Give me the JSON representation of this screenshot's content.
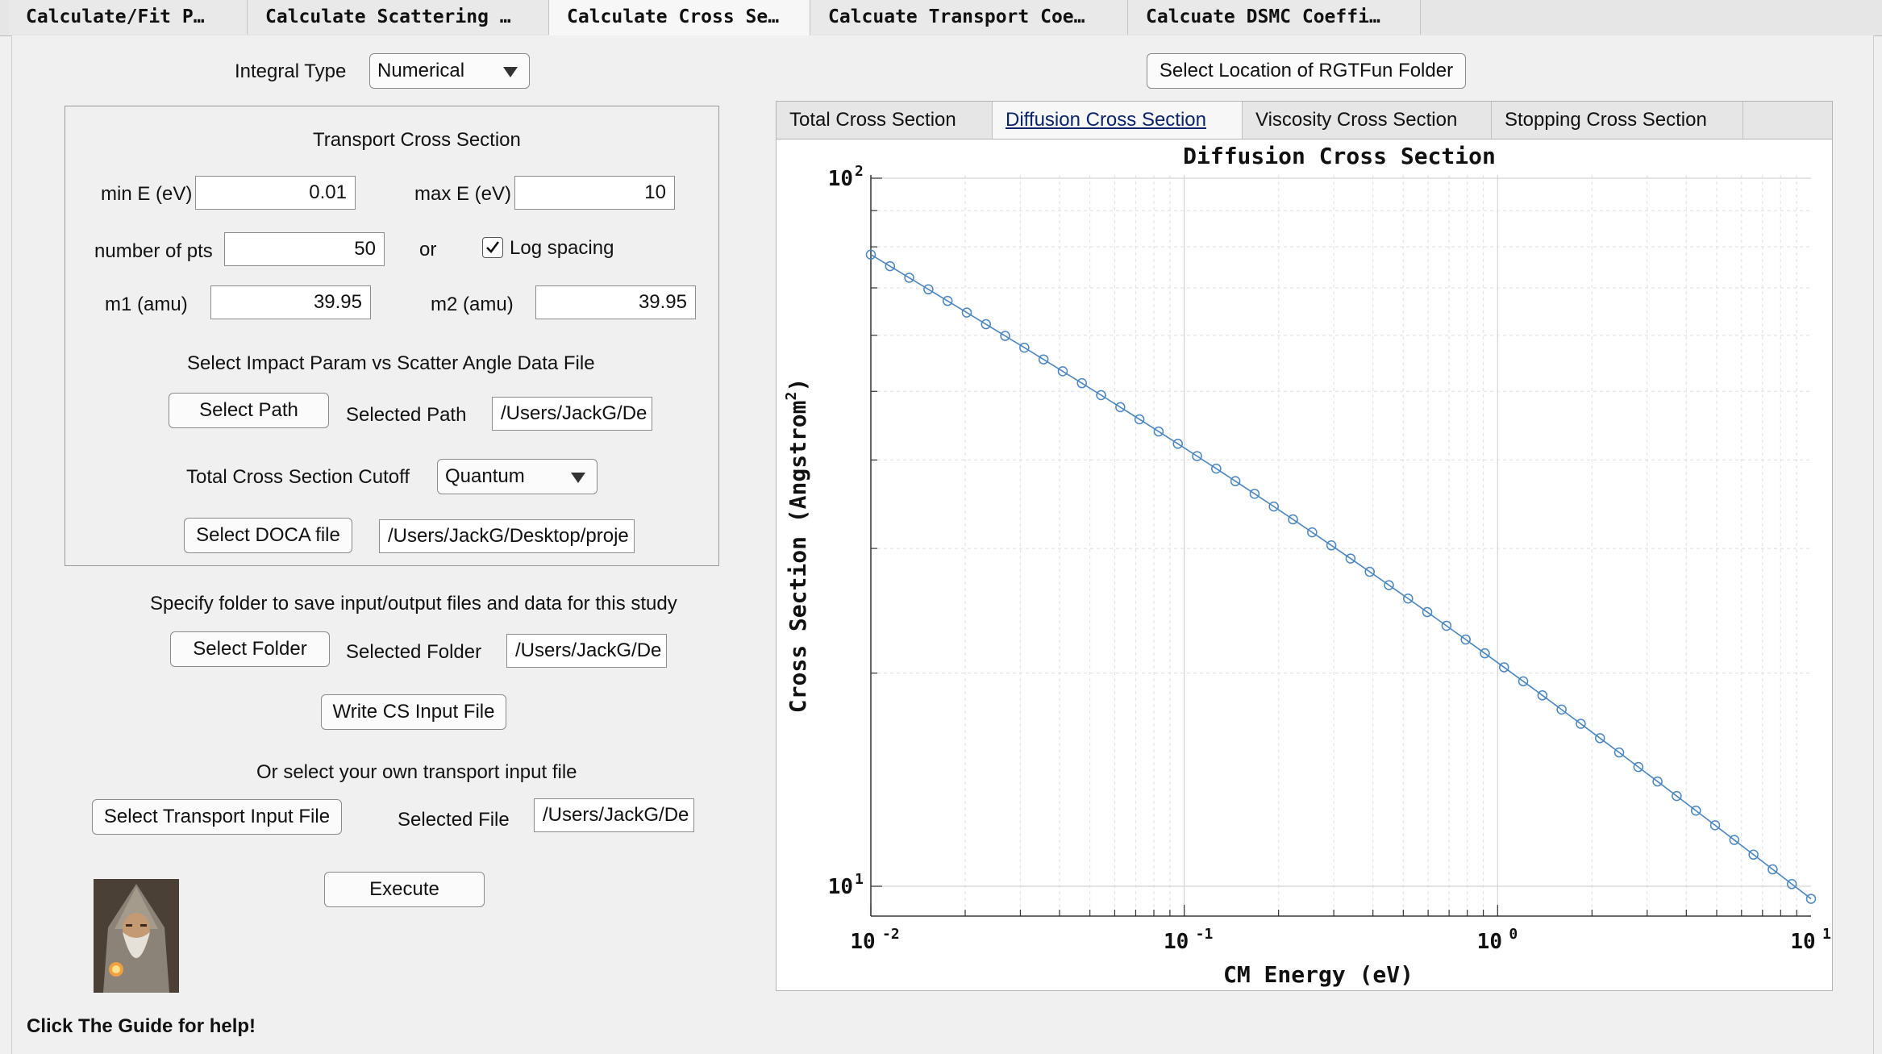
{
  "tabs": [
    {
      "label": "Calculate/Fit P…"
    },
    {
      "label": "Calculate Scattering …"
    },
    {
      "label": "Calculate Cross Se…"
    },
    {
      "label": "Calcuate Transport Coe…"
    },
    {
      "label": "Calcuate DSMC Coeffi…"
    }
  ],
  "integral": {
    "label": "Integral Type",
    "value": "Numerical"
  },
  "rgtfun_button": "Select Location of RGTFun Folder",
  "transport": {
    "title": "Transport Cross Section",
    "min_e_label": "min E (eV)",
    "min_e_value": "0.01",
    "max_e_label": "max E (eV)",
    "max_e_value": "10",
    "npts_label": "number of pts",
    "npts_value": "50",
    "or_label": "or",
    "log_label": "Log spacing",
    "log_checked": true,
    "m1_label": "m1 (amu)",
    "m1_value": "39.95",
    "m2_label": "m2 (amu)",
    "m2_value": "39.95",
    "impact_label": "Select Impact Param vs Scatter Angle Data File",
    "select_path_button": "Select Path",
    "selected_path_label": "Selected Path",
    "selected_path_value": "/Users/JackG/De",
    "cutoff_label": "Total Cross Section Cutoff",
    "cutoff_value": "Quantum",
    "doca_button": "Select DOCA file",
    "doca_value": "/Users/JackG/Desktop/proje"
  },
  "save": {
    "label": "Specify folder to save input/output files and data for this study",
    "select_folder_button": "Select Folder",
    "selected_folder_label": "Selected Folder",
    "selected_folder_value": "/Users/JackG/De",
    "write_button": "Write CS Input File",
    "own_label": "Or select your own transport input file",
    "select_file_button": "Select Transport Input File",
    "selected_file_label": "Selected File",
    "selected_file_value": "/Users/JackG/De",
    "execute_button": "Execute"
  },
  "help_text": "Click The Guide for help!",
  "plot_tabs": [
    {
      "label": "Total Cross Section"
    },
    {
      "label": "Diffusion Cross Section"
    },
    {
      "label": "Viscosity Cross Section"
    },
    {
      "label": "Stopping Cross Section"
    }
  ],
  "colors": {
    "series": "#4a86c0",
    "accent_tab": "#0a246a"
  },
  "chart_data": {
    "type": "line",
    "title": "Diffusion Cross Section",
    "xlabel": "CM Energy (eV)",
    "ylabel_main": "Cross Section (Angstrom",
    "ylabel_sup": "2",
    "ylabel_end": ")",
    "x_scale": "log",
    "y_scale": "log",
    "xlim": [
      0.01,
      10
    ],
    "ylim": [
      10,
      100
    ],
    "grid": true,
    "x_ticks": [
      {
        "base": "10",
        "exp": "-2",
        "value": 0.01
      },
      {
        "base": "10",
        "exp": "-1",
        "value": 0.1
      },
      {
        "base": "10",
        "exp": "0",
        "value": 1
      },
      {
        "base": "10",
        "exp": "1",
        "value": 10
      }
    ],
    "y_ticks": [
      {
        "base": "10",
        "exp": "1",
        "value": 10
      },
      {
        "base": "10",
        "exp": "2",
        "value": 100
      }
    ],
    "marker": "circle",
    "series": [
      {
        "x_start": 0.01,
        "x_end": 10,
        "n_points": 50,
        "y_start": 78,
        "y_end": 9.6
      }
    ]
  }
}
